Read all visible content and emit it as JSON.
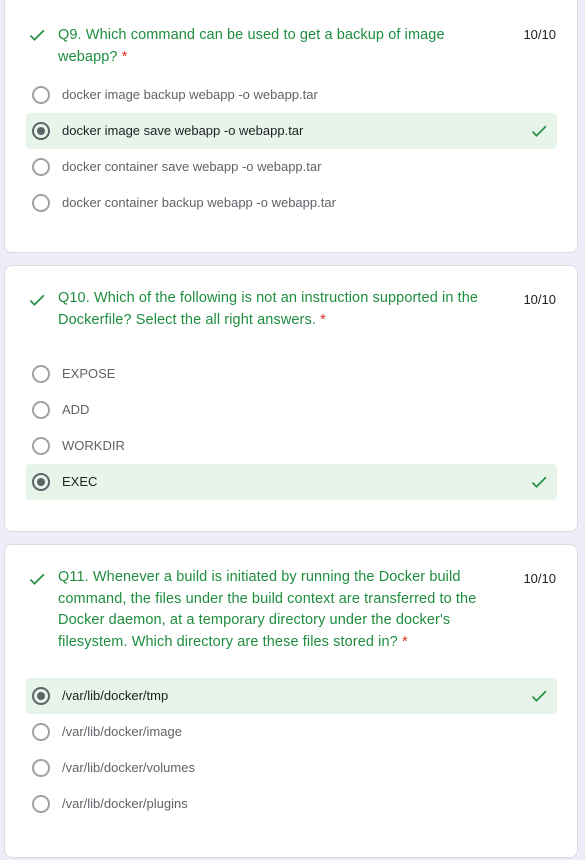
{
  "colors": {
    "background": "#f0ebf8",
    "card": "#ffffff",
    "correct_text": "#1e8e3e",
    "correct_fill": "#e6f4ea",
    "required": "#d93025"
  },
  "questions": [
    {
      "text": "Q9. Which command can be used to get a backup of image webapp?",
      "required_mark": "*",
      "score": "10/10",
      "status_icon": "check-icon",
      "options": [
        {
          "label": "docker image backup webapp -o webapp.tar",
          "selected": false,
          "correct": false
        },
        {
          "label": "docker image save webapp -o webapp.tar",
          "selected": true,
          "correct": true
        },
        {
          "label": "docker container save webapp -o webapp.tar",
          "selected": false,
          "correct": false
        },
        {
          "label": "docker container backup webapp -o webapp.tar",
          "selected": false,
          "correct": false
        }
      ]
    },
    {
      "text": "Q10. Which of the following is not an instruction supported in the Dockerfile? Select the all right answers.",
      "required_mark": "*",
      "score": "10/10",
      "status_icon": "check-icon",
      "options": [
        {
          "label": "EXPOSE",
          "selected": false,
          "correct": false
        },
        {
          "label": "ADD",
          "selected": false,
          "correct": false
        },
        {
          "label": "WORKDIR",
          "selected": false,
          "correct": false
        },
        {
          "label": "EXEC",
          "selected": true,
          "correct": true
        }
      ]
    },
    {
      "text": "Q11. Whenever a build is initiated by running the Docker build command, the files under the build context are transferred to the Docker daemon, at a temporary directory under the docker's filesystem. Which directory are these files stored in?",
      "required_mark": "*",
      "score": "10/10",
      "status_icon": "check-icon",
      "options": [
        {
          "label": "/var/lib/docker/tmp",
          "selected": true,
          "correct": true
        },
        {
          "label": "/var/lib/docker/image",
          "selected": false,
          "correct": false
        },
        {
          "label": "/var/lib/docker/volumes",
          "selected": false,
          "correct": false
        },
        {
          "label": "/var/lib/docker/plugins",
          "selected": false,
          "correct": false
        }
      ]
    }
  ]
}
